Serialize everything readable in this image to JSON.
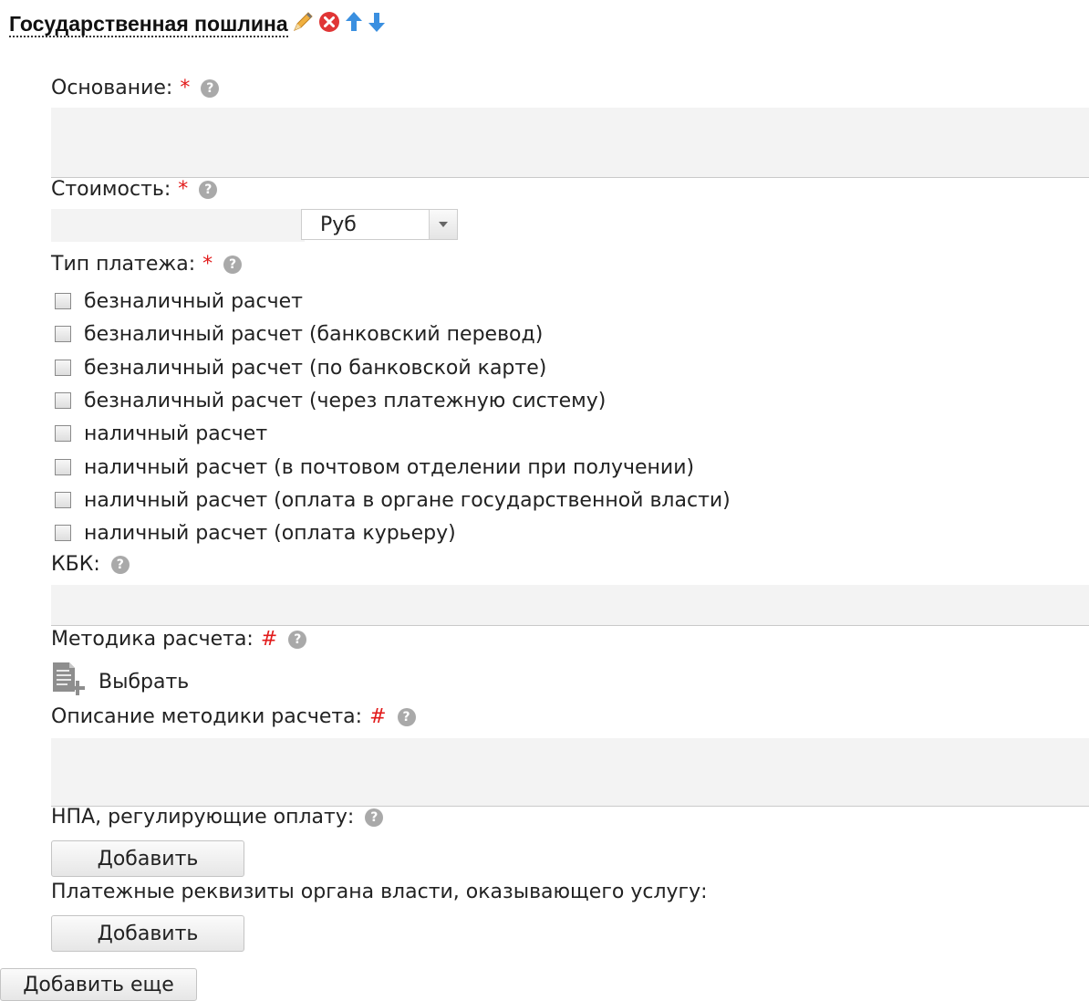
{
  "header": {
    "title": "Государственная пошлина",
    "icons": [
      "edit-pencil-icon",
      "delete-icon",
      "move-up-icon",
      "move-down-icon"
    ],
    "colors": {
      "delete": "#e03030",
      "arrows": "#3a8fe0",
      "pencil": "#e8a020"
    }
  },
  "form": {
    "basis": {
      "label": "Основание:",
      "required_mark": "*",
      "value": ""
    },
    "cost": {
      "label": "Стоимость:",
      "required_mark": "*",
      "value": "",
      "currency": "Руб"
    },
    "payment_type": {
      "label": "Тип платежа:",
      "required_mark": "*",
      "options": [
        "безналичный расчет",
        "безналичный расчет (банковский перевод)",
        "безналичный расчет (по банковской карте)",
        "безналичный расчет (через платежную систему)",
        "наличный расчет",
        "наличный расчет (в почтовом отделении при получении)",
        "наличный расчет (оплата в органе государственной власти)",
        "наличный расчет (оплата курьеру)"
      ]
    },
    "kbk": {
      "label": "КБК:",
      "value": ""
    },
    "method": {
      "label": "Методика расчета:",
      "mark": "#",
      "pick_label": "Выбрать"
    },
    "method_description": {
      "label": "Описание методики расчета:",
      "mark": "#",
      "value": ""
    },
    "npa": {
      "label": "НПА, регулирующие оплату:",
      "button": "Добавить"
    },
    "requisites": {
      "label": "Платежные реквизиты органа власти, оказывающего услугу:",
      "button": "Добавить"
    }
  },
  "footer": {
    "add_more": "Добавить еще"
  },
  "help_glyph": "?"
}
